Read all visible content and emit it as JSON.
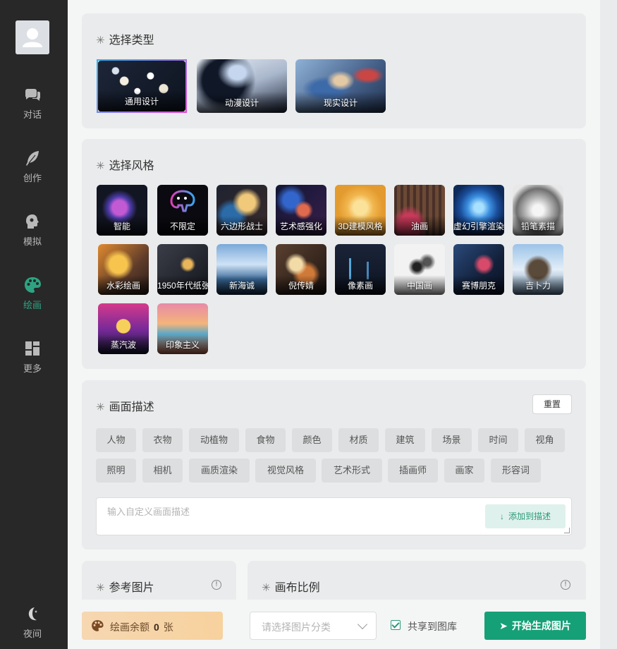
{
  "sidebar": {
    "items": [
      {
        "label": "对话",
        "icon": "chat-icon"
      },
      {
        "label": "创作",
        "icon": "feather-icon"
      },
      {
        "label": "模拟",
        "icon": "head-icon"
      },
      {
        "label": "绘画",
        "icon": "palette-icon",
        "active": true
      },
      {
        "label": "更多",
        "icon": "grid-icon"
      }
    ],
    "night_label": "夜间"
  },
  "type_section": {
    "title": "选择类型",
    "tiles": [
      {
        "label": "通用设计",
        "selected": true
      },
      {
        "label": "动漫设计"
      },
      {
        "label": "现实设计"
      }
    ]
  },
  "style_section": {
    "title": "选择风格",
    "tiles": [
      {
        "label": "智能",
        "selected": true
      },
      {
        "label": "不限定"
      },
      {
        "label": "六边形战士"
      },
      {
        "label": "艺术感强化"
      },
      {
        "label": "3D建模风格"
      },
      {
        "label": "油画"
      },
      {
        "label": "虚幻引擎渲染"
      },
      {
        "label": "铅笔素描"
      },
      {
        "label": "水彩绘画"
      },
      {
        "label": "1950年代纸张"
      },
      {
        "label": "新海诚"
      },
      {
        "label": "倪传婧"
      },
      {
        "label": "像素画"
      },
      {
        "label": "中国画"
      },
      {
        "label": "赛博朋克"
      },
      {
        "label": "吉卜力"
      },
      {
        "label": "蒸汽波"
      },
      {
        "label": "印象主义"
      }
    ]
  },
  "desc_section": {
    "title": "画面描述",
    "reset_label": "重置",
    "tags_row1": [
      "人物",
      "衣物",
      "动植物",
      "食物",
      "颜色",
      "材质",
      "建筑",
      "场景",
      "时间",
      "视角"
    ],
    "tags_row2": [
      "照明",
      "相机",
      "画质渲染",
      "视觉风格",
      "艺术形式",
      "插画师",
      "画家",
      "形容词"
    ],
    "placeholder": "输入自定义画面描述",
    "add_label": "添加到描述"
  },
  "ref_section": {
    "title": "参考图片"
  },
  "ratio_section": {
    "title": "画布比例"
  },
  "bottom": {
    "balance_prefix": "绘画余额",
    "balance_value": "0",
    "balance_unit": "张",
    "category_placeholder": "请选择图片分类",
    "share_label": "共享到图库",
    "generate_label": "开始生成图片"
  },
  "colors": {
    "accent": "#16a077",
    "sidebar_bg": "#282828"
  }
}
